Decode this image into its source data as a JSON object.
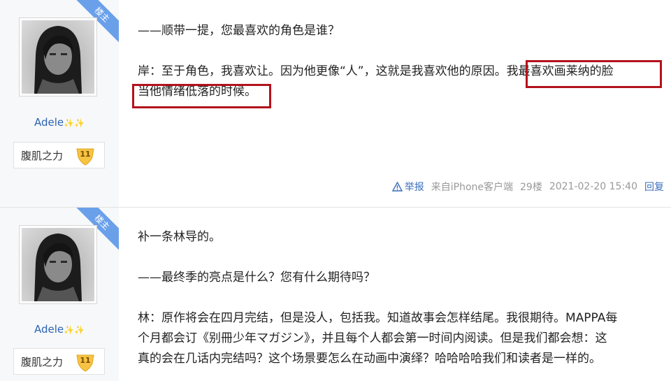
{
  "posts": [
    {
      "author": {
        "owner_tag": "楼主",
        "username": "Adele",
        "sparkles": "✨✨",
        "badge_name": "腹肌之力",
        "badge_level": "11"
      },
      "lines": [
        "——顺带一提，您最喜欢的角色是谁？",
        "",
        "岸：至于角色，我喜欢让。因为他更像“人”，这就是我喜欢他的原因。我最喜欢画莱纳的脸",
        "当他情绪低落的时候。"
      ],
      "highlighted_text": [
        "我最喜欢画莱纳的脸",
        "当他情绪低落的时候。"
      ],
      "footer": {
        "report": "举报",
        "source": "来自iPhone客户端",
        "floor": "29楼",
        "datetime": "2021-02-20 15:40",
        "reply": "回复"
      }
    },
    {
      "author": {
        "owner_tag": "楼主",
        "username": "Adele",
        "sparkles": "✨✨",
        "badge_name": "腹肌之力",
        "badge_level": "11"
      },
      "lines": [
        "补一条林导的。",
        "",
        "——最终季的亮点是什么？您有什么期待吗？",
        "",
        "林：原作将会在四月完结，但是没人，包括我。知道故事会怎样结尾。我很期待。MAPPA每",
        "个月都会订《别冊少年マガジン》，并且每个人都会第一时间内阅读。但是我们都会想：这",
        "真的会在几话内完结吗？这个场景要怎么在动画中演绎？哈哈哈哈我们和读者是一样的。"
      ]
    }
  ],
  "colors": {
    "highlight_border": "#b3121d",
    "username": "#2d64b3",
    "link": "#3a6fbd",
    "ribbon": "#6aa0ea"
  }
}
